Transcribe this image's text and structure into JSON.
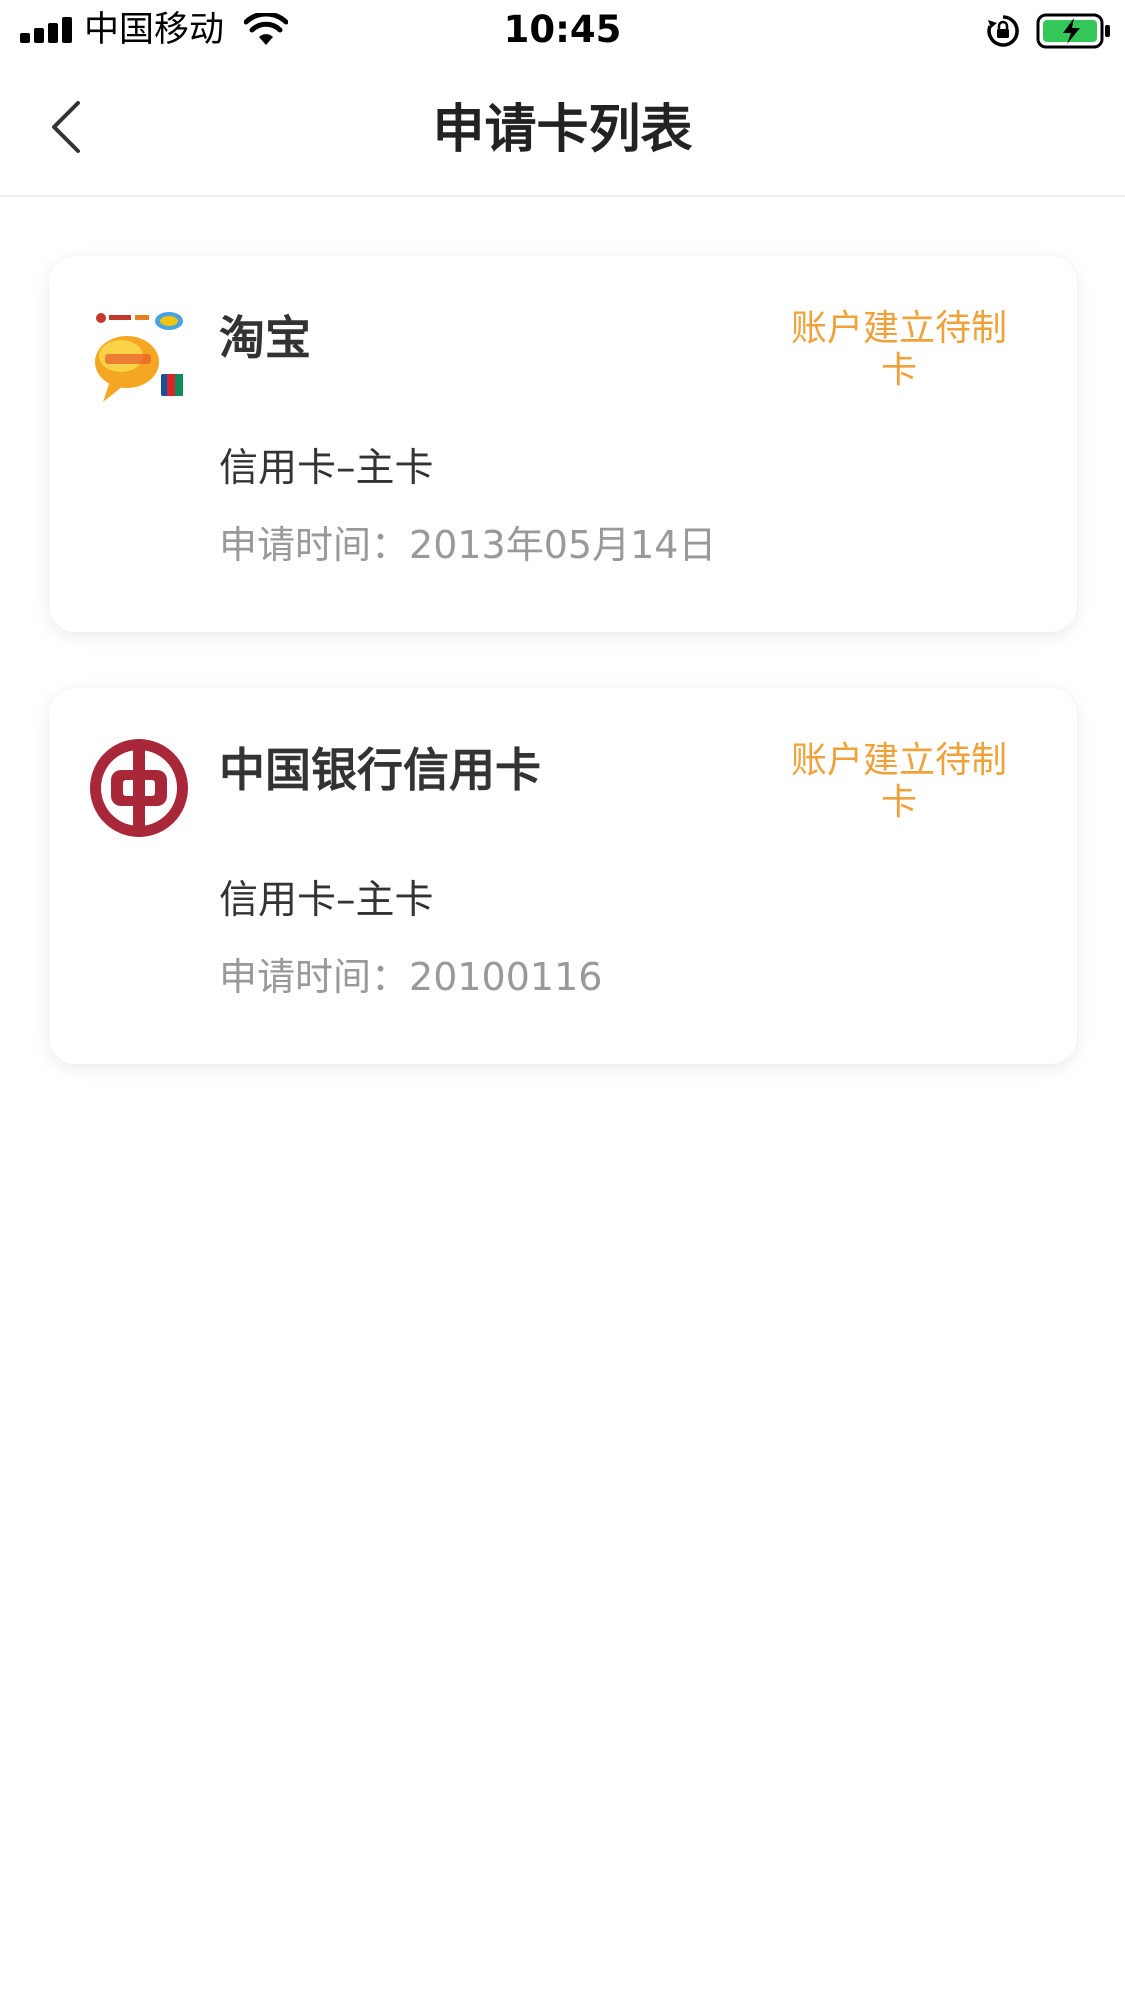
{
  "status_bar": {
    "carrier": "中国移动",
    "time": "10:45"
  },
  "nav": {
    "title": "申请卡列表",
    "back_icon": "chevron-left-icon"
  },
  "cards": [
    {
      "name": "淘宝",
      "status": "账户建立待制卡",
      "type": "信用卡–主卡",
      "date_label": "申请时间：",
      "date_value": "2013年05月14日",
      "logo": "taobao-card-icon"
    },
    {
      "name": "中国银行信用卡",
      "status": "账户建立待制卡",
      "type": "信用卡–主卡",
      "date_label": "申请时间：",
      "date_value": "20100116",
      "logo": "bank-of-china-logo-icon"
    }
  ],
  "colors": {
    "status_accent": "#f0a23a",
    "boc_red": "#a8283a",
    "battery_green": "#34c759"
  }
}
